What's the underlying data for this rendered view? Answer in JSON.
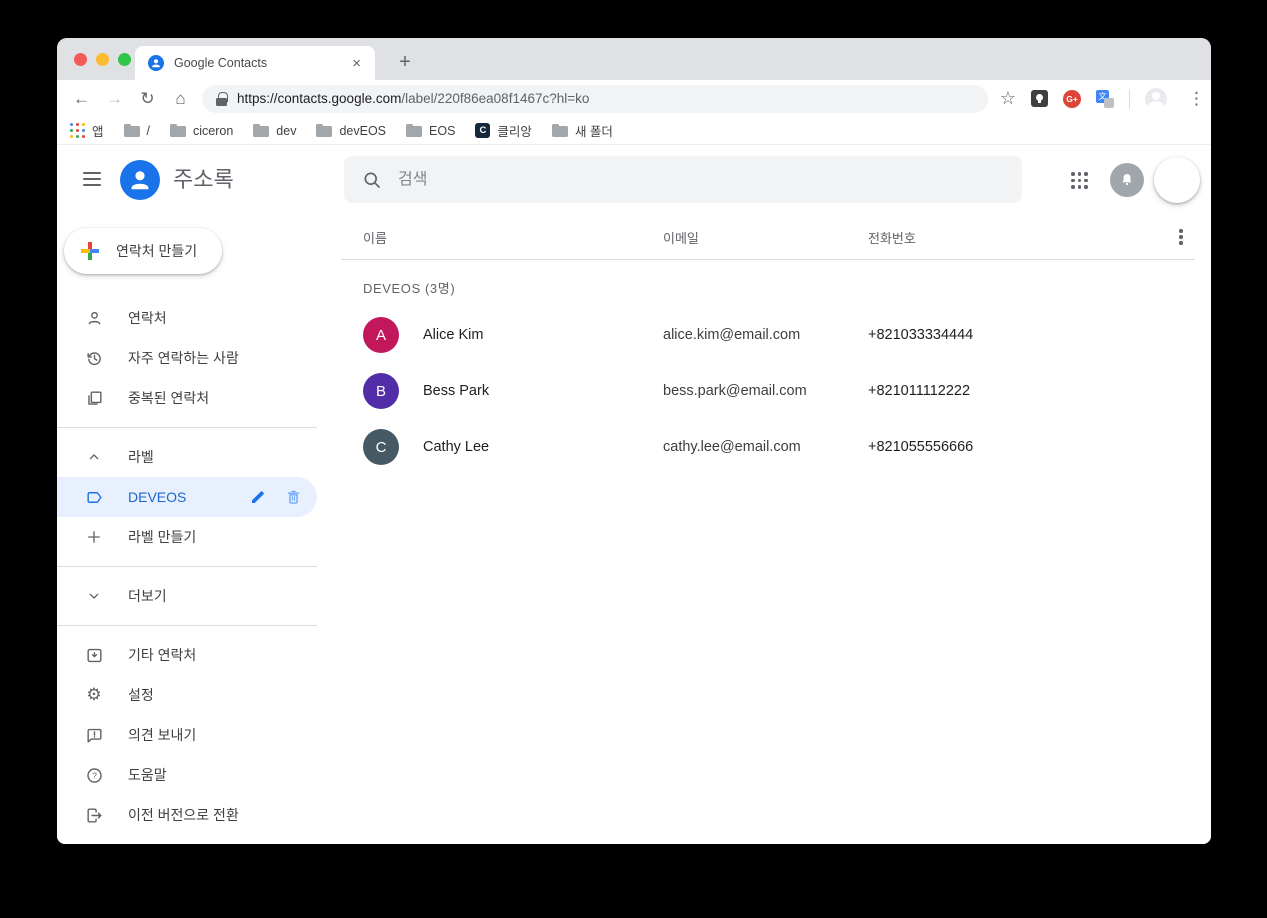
{
  "browser": {
    "tab": {
      "title": "Google Contacts"
    },
    "omnibox": {
      "url_host": "https://contacts.google.com",
      "url_path": "/label/220f86ea08f1467c?hl=ko"
    },
    "bookmarks": [
      {
        "icon": "apps-grid",
        "label": "앱"
      },
      {
        "icon": "folder",
        "label": "/"
      },
      {
        "icon": "folder",
        "label": "ciceron"
      },
      {
        "icon": "folder",
        "label": "dev"
      },
      {
        "icon": "folder",
        "label": "devEOS"
      },
      {
        "icon": "folder",
        "label": "EOS"
      },
      {
        "icon": "clien-favicon",
        "label": "클리앙"
      },
      {
        "icon": "folder",
        "label": "새 폴더"
      }
    ]
  },
  "icons": {
    "back": "←",
    "forward": "→",
    "reload": "↻",
    "home": "⌂",
    "star": "☆",
    "menu": "⋮",
    "new_tab": "+",
    "tab_close": "×",
    "gplus": "G+",
    "translate": "文",
    "clien": "C",
    "settings": "⚙",
    "help": "?"
  },
  "header": {
    "title": "주소록",
    "search_placeholder": "검색"
  },
  "sidebar": {
    "create_contact": "연락처 만들기",
    "items": [
      {
        "icon": "person-icon",
        "label": "연락처"
      },
      {
        "icon": "history-icon",
        "label": "자주 연락하는 사람"
      },
      {
        "icon": "duplicate-icon",
        "label": "중복된 연락처"
      }
    ],
    "labels_header": "라벨",
    "selected_label": "DEVEOS",
    "create_label": "라벨 만들기",
    "more": "더보기",
    "footer_items": [
      {
        "icon": "other-contacts-icon",
        "label": "기타 연락처"
      },
      {
        "icon": "settings-icon",
        "label": "설정"
      },
      {
        "icon": "feedback-icon",
        "label": "의견 보내기"
      },
      {
        "icon": "help-icon",
        "label": "도움말"
      },
      {
        "icon": "switch-version-icon",
        "label": "이전 버전으로 전환"
      }
    ]
  },
  "table": {
    "columns": [
      "이름",
      "이메일",
      "전화번호"
    ],
    "group_header": "DEVEOS (3명)",
    "contacts": [
      {
        "initial": "A",
        "name": "Alice Kim",
        "email": "alice.kim@email.com",
        "phone": "+821033334444",
        "avatar_color": "#C2185B"
      },
      {
        "initial": "B",
        "name": "Bess Park",
        "email": "bess.park@email.com",
        "phone": "+821011112222",
        "avatar_color": "#512DA8"
      },
      {
        "initial": "C",
        "name": "Cathy Lee",
        "email": "cathy.lee@email.com",
        "phone": "+821055556666",
        "avatar_color": "#455A64"
      }
    ]
  },
  "colors": {
    "accent_blue": "#1A73E8",
    "selected_bg": "#E8F0FE",
    "selected_text": "#1967D2"
  }
}
